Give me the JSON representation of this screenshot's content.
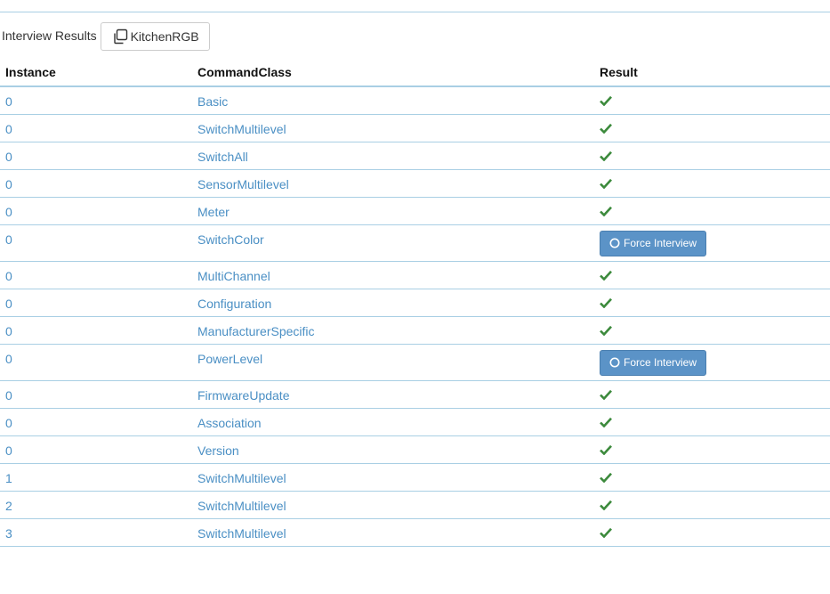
{
  "header": {
    "title": "Interview Results",
    "node_button_label": "KitchenRGB"
  },
  "table": {
    "columns": [
      "Instance",
      "CommandClass",
      "Result"
    ],
    "force_label": "Force Interview",
    "rows": [
      {
        "instance": "0",
        "command_class": "Basic",
        "result": "ok"
      },
      {
        "instance": "0",
        "command_class": "SwitchMultilevel",
        "result": "ok"
      },
      {
        "instance": "0",
        "command_class": "SwitchAll",
        "result": "ok"
      },
      {
        "instance": "0",
        "command_class": "SensorMultilevel",
        "result": "ok"
      },
      {
        "instance": "0",
        "command_class": "Meter",
        "result": "ok"
      },
      {
        "instance": "0",
        "command_class": "SwitchColor",
        "result": "force"
      },
      {
        "instance": "0",
        "command_class": "MultiChannel",
        "result": "ok"
      },
      {
        "instance": "0",
        "command_class": "Configuration",
        "result": "ok"
      },
      {
        "instance": "0",
        "command_class": "ManufacturerSpecific",
        "result": "ok"
      },
      {
        "instance": "0",
        "command_class": "PowerLevel",
        "result": "force"
      },
      {
        "instance": "0",
        "command_class": "FirmwareUpdate",
        "result": "ok"
      },
      {
        "instance": "0",
        "command_class": "Association",
        "result": "ok"
      },
      {
        "instance": "0",
        "command_class": "Version",
        "result": "ok"
      },
      {
        "instance": "1",
        "command_class": "SwitchMultilevel",
        "result": "ok"
      },
      {
        "instance": "2",
        "command_class": "SwitchMultilevel",
        "result": "ok"
      },
      {
        "instance": "3",
        "command_class": "SwitchMultilevel",
        "result": "ok"
      }
    ]
  },
  "colors": {
    "link": "#4a8fc4",
    "check": "#3c8a3c",
    "force_button": "#5b93c7",
    "rule": "#a9cfe4"
  },
  "icons": {
    "node_button": "copy-icon",
    "ok_result": "check-icon",
    "force_button": "circle-icon"
  }
}
